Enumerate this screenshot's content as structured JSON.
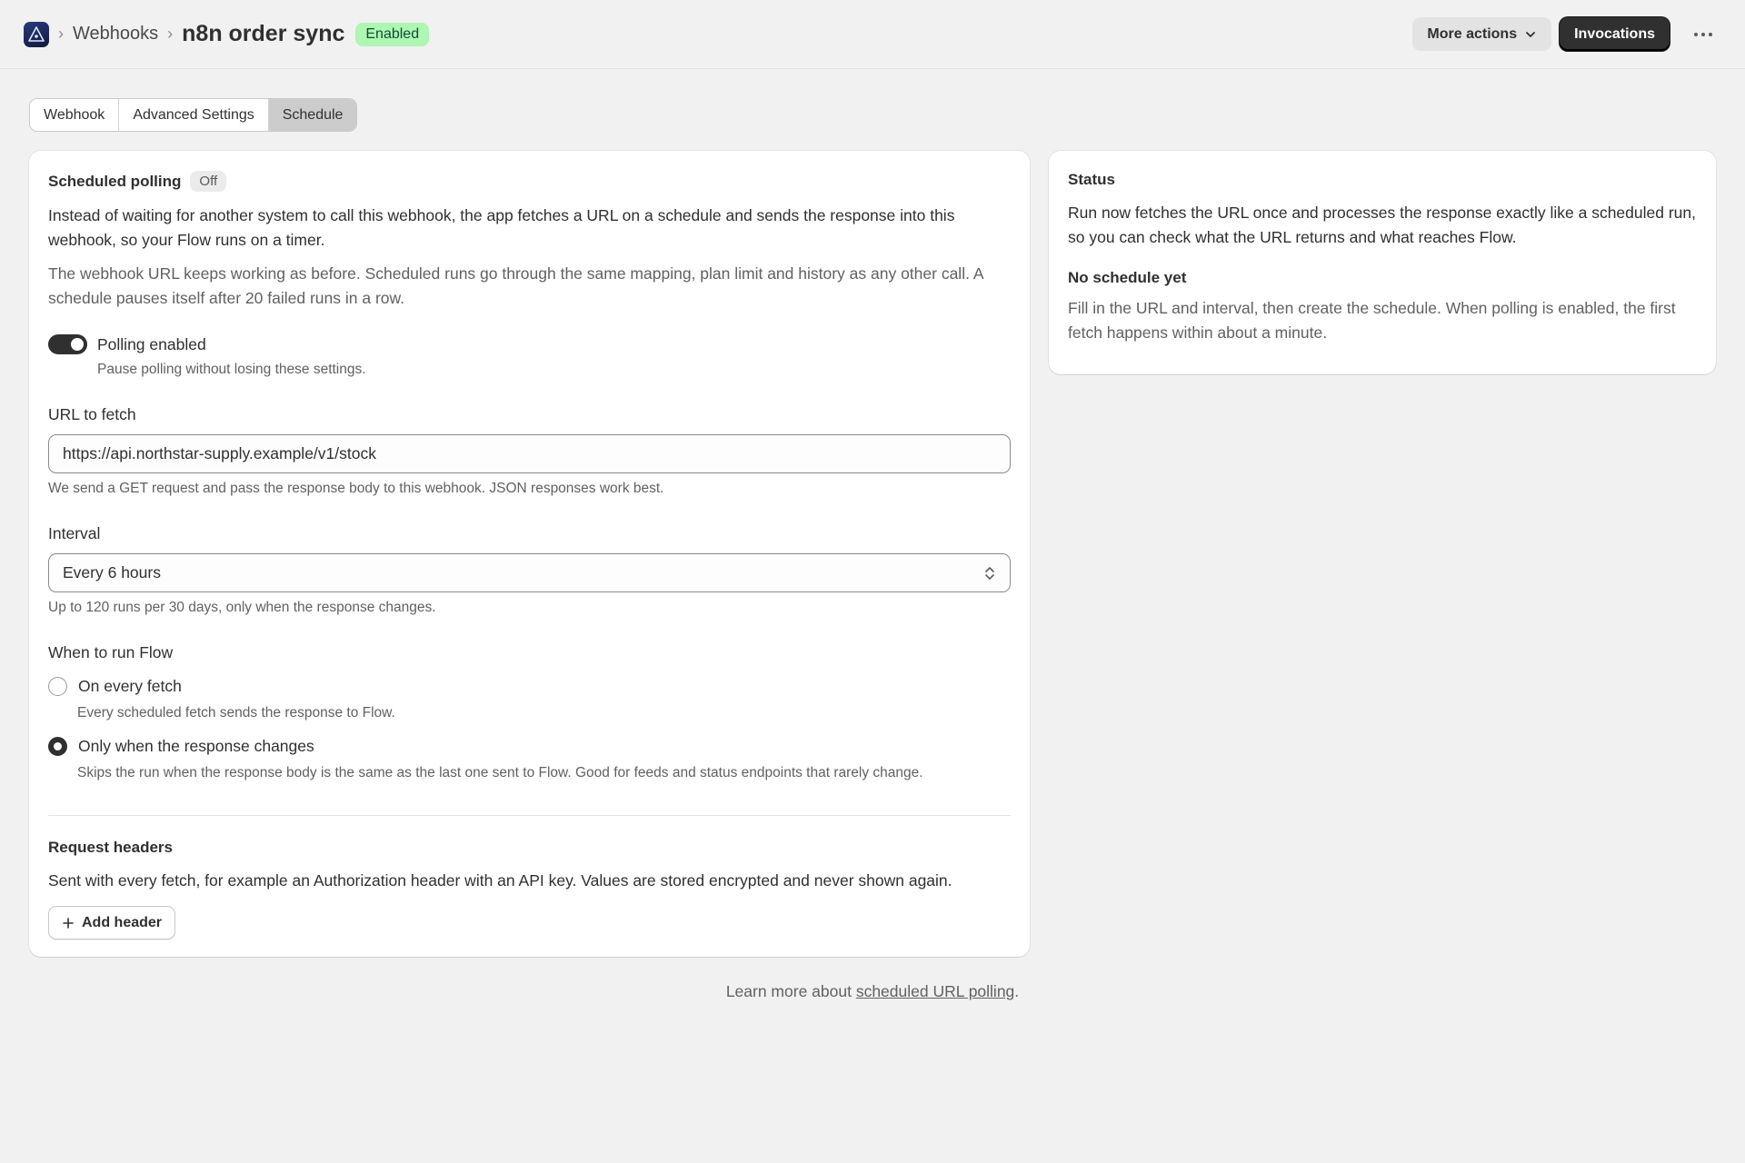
{
  "header": {
    "breadcrumb_parent": "Webhooks",
    "title": "n8n order sync",
    "status_badge": "Enabled",
    "more_actions_label": "More actions",
    "invocations_label": "Invocations",
    "overflow_icon": "ellipsis-icon",
    "logo_icon": "app-logo-icon"
  },
  "tabs": [
    {
      "label": "Webhook",
      "active": false
    },
    {
      "label": "Advanced Settings",
      "active": false
    },
    {
      "label": "Schedule",
      "active": true
    }
  ],
  "main": {
    "title": "Scheduled polling",
    "state_pill": "Off",
    "intro": "Instead of waiting for another system to call this webhook, the app fetches a URL on a schedule and sends the response into this webhook, so your Flow runs on a timer.",
    "note": "The webhook URL keeps working as before. Scheduled runs go through the same mapping, plan limit and history as any other call. A schedule pauses itself after 20 failed runs in a row.",
    "toggle": {
      "label": "Polling enabled",
      "help": "Pause polling without losing these settings.",
      "on": true
    },
    "url": {
      "label": "URL to fetch",
      "value": "https://api.northstar-supply.example/v1/stock",
      "help": "We send a GET request and pass the response body to this webhook. JSON responses work best."
    },
    "interval": {
      "label": "Interval",
      "value": "Every 6 hours",
      "help": "Up to 120 runs per 30 days, only when the response changes."
    },
    "run_flow": {
      "label": "When to run Flow",
      "options": [
        {
          "label": "On every fetch",
          "help": "Every scheduled fetch sends the response to Flow.",
          "selected": false
        },
        {
          "label": "Only when the response changes",
          "help": "Skips the run when the response body is the same as the last one sent to Flow. Good for feeds and status endpoints that rarely change.",
          "selected": true
        }
      ]
    },
    "headers": {
      "title": "Request headers",
      "description": "Sent with every fetch, for example an Authorization header with an API key. Values are stored encrypted and never shown again.",
      "add_label": "Add header"
    }
  },
  "status_card": {
    "title": "Status",
    "description": "Run now fetches the URL once and processes the response exactly like a scheduled run, so you can check what the URL returns and what reaches Flow.",
    "subtitle": "No schedule yet",
    "subtext": "Fill in the URL and interval, then create the schedule. When polling is enabled, the first fetch happens within about a minute."
  },
  "footer": {
    "prefix": "Learn more about ",
    "link": "scheduled URL polling",
    "suffix": "."
  },
  "colors": {
    "badge_bg": "#aff5b4",
    "badge_text": "#0c5132",
    "primary": "#303030",
    "background": "#f1f1f1"
  }
}
